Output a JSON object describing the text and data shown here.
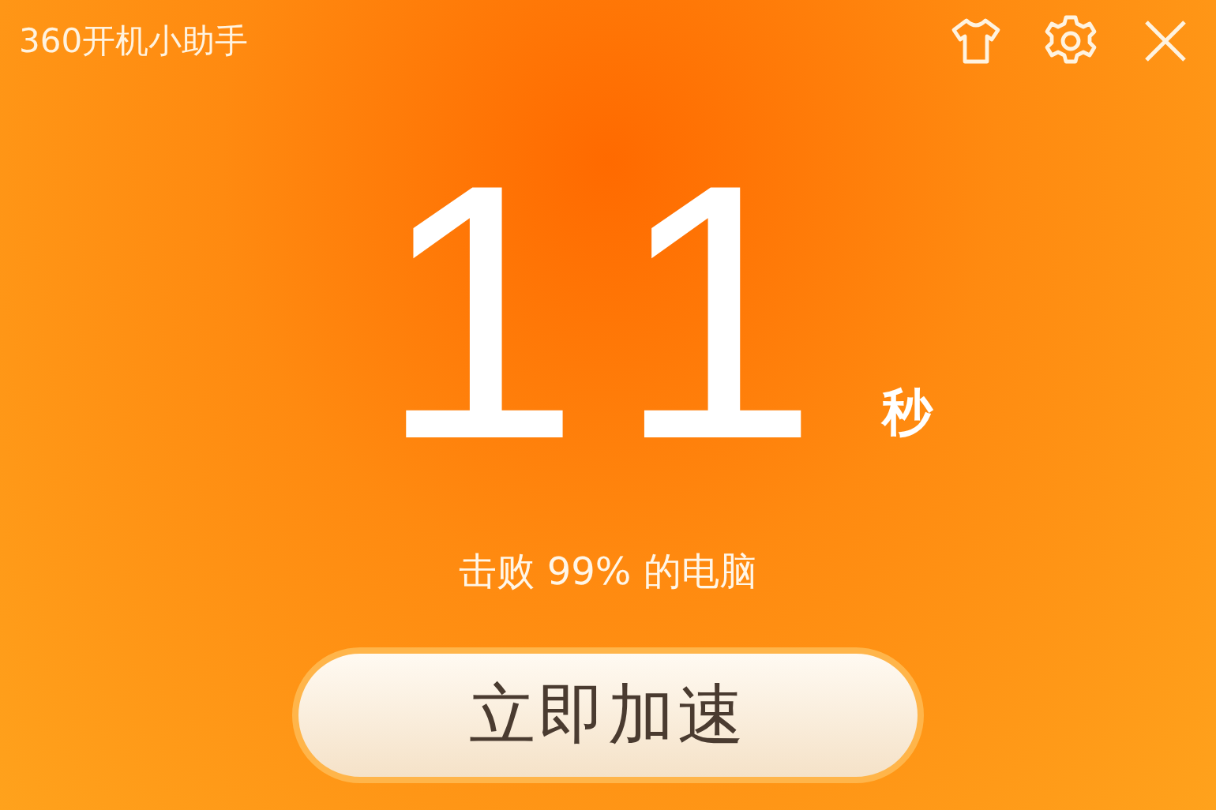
{
  "window": {
    "title": "360开机小助手"
  },
  "result": {
    "value": "11",
    "unit": "秒",
    "caption": "击败 99% 的电脑"
  },
  "action": {
    "label": "立即加速"
  }
}
